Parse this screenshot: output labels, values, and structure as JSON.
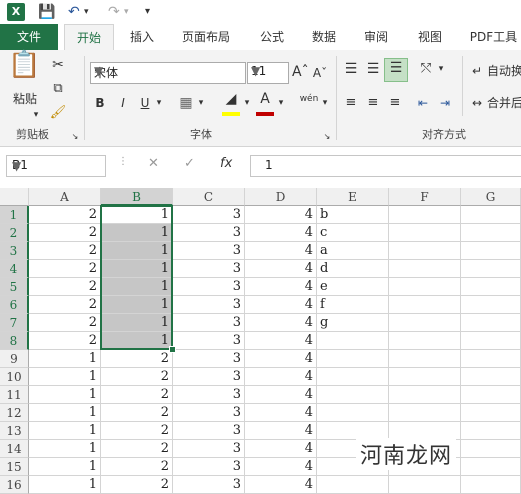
{
  "qat": {
    "app_icon": "X",
    "save_icon": "save-icon",
    "undo_icon": "undo-icon",
    "redo_icon": "redo-icon"
  },
  "tabs": [
    "文件",
    "开始",
    "插入",
    "页面布局",
    "公式",
    "数据",
    "审阅",
    "视图",
    "PDF工具"
  ],
  "ribbon": {
    "paste_label": "粘贴",
    "clipboard_label": "剪贴板",
    "font_name": "宋体",
    "font_size": "11",
    "font_group_label": "字体",
    "bold": "B",
    "italic": "I",
    "underline": "U",
    "phonetic": "wén",
    "align_group_label": "对齐方式",
    "wrap_label": "自动换",
    "merge_label": "合并后"
  },
  "formula_bar": {
    "name_box": "B1",
    "fx": "fx",
    "value": "1"
  },
  "columns": [
    "A",
    "B",
    "C",
    "D",
    "E",
    "F",
    "G"
  ],
  "rows": [
    {
      "n": "1",
      "a": "2",
      "b": "1",
      "c": "3",
      "d": "4",
      "e": "b"
    },
    {
      "n": "2",
      "a": "2",
      "b": "1",
      "c": "3",
      "d": "4",
      "e": "c"
    },
    {
      "n": "3",
      "a": "2",
      "b": "1",
      "c": "3",
      "d": "4",
      "e": "a"
    },
    {
      "n": "4",
      "a": "2",
      "b": "1",
      "c": "3",
      "d": "4",
      "e": "d"
    },
    {
      "n": "5",
      "a": "2",
      "b": "1",
      "c": "3",
      "d": "4",
      "e": "e"
    },
    {
      "n": "6",
      "a": "2",
      "b": "1",
      "c": "3",
      "d": "4",
      "e": "f"
    },
    {
      "n": "7",
      "a": "2",
      "b": "1",
      "c": "3",
      "d": "4",
      "e": "g"
    },
    {
      "n": "8",
      "a": "2",
      "b": "1",
      "c": "3",
      "d": "4",
      "e": ""
    },
    {
      "n": "9",
      "a": "1",
      "b": "2",
      "c": "3",
      "d": "4",
      "e": ""
    },
    {
      "n": "10",
      "a": "1",
      "b": "2",
      "c": "3",
      "d": "4",
      "e": ""
    },
    {
      "n": "11",
      "a": "1",
      "b": "2",
      "c": "3",
      "d": "4",
      "e": ""
    },
    {
      "n": "12",
      "a": "1",
      "b": "2",
      "c": "3",
      "d": "4",
      "e": ""
    },
    {
      "n": "13",
      "a": "1",
      "b": "2",
      "c": "3",
      "d": "4",
      "e": ""
    },
    {
      "n": "14",
      "a": "1",
      "b": "2",
      "c": "3",
      "d": "4",
      "e": ""
    },
    {
      "n": "15",
      "a": "1",
      "b": "2",
      "c": "3",
      "d": "4",
      "e": ""
    },
    {
      "n": "16",
      "a": "1",
      "b": "2",
      "c": "3",
      "d": "4",
      "e": ""
    }
  ],
  "watermark": "河南龙网",
  "colors": {
    "accent": "#217346",
    "highlight": "#c6c6c6",
    "ribbon_bg": "#f3f3f3"
  }
}
